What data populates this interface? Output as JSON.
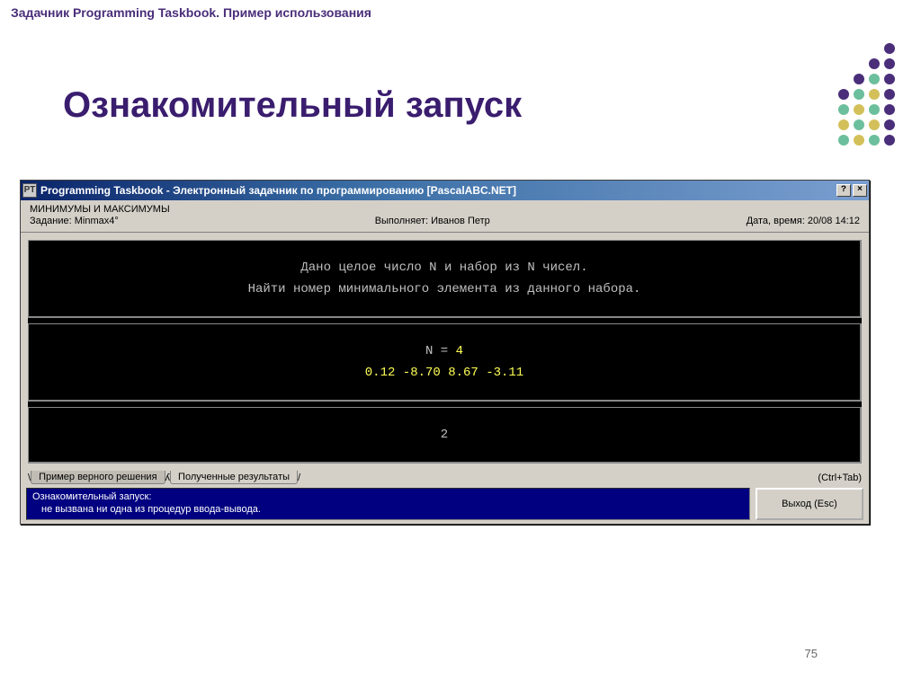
{
  "slide": {
    "header": "Задачник Programming Taskbook. Пример использования",
    "title": "Ознакомительный запуск",
    "page_number": "75"
  },
  "dots": [
    [
      "",
      "",
      "",
      "#4a2e7a",
      ""
    ],
    [
      "",
      "",
      "#4a2e7a",
      "#4a2e7a",
      ""
    ],
    [
      "",
      "#4a2e7a",
      "#6cbf9c",
      "#4a2e7a",
      ""
    ],
    [
      "#4a2e7a",
      "#6cbf9c",
      "#d4c05a",
      "#4a2e7a",
      ""
    ],
    [
      "#6cbf9c",
      "#d4c05a",
      "#6cbf9c",
      "#4a2e7a",
      ""
    ],
    [
      "#d4c05a",
      "#6cbf9c",
      "#d4c05a",
      "#4a2e7a",
      ""
    ],
    [
      "#6cbf9c",
      "#d4c05a",
      "#6cbf9c",
      "#4a2e7a",
      ""
    ]
  ],
  "window": {
    "title": "Programming Taskbook - Электронный задачник по программированию [PascalABC.NET]",
    "icon_text": "PT",
    "help_btn": "?",
    "close_btn": "×"
  },
  "info": {
    "section": "МИНИМУМЫ И МАКСИМУМЫ",
    "task_label": "Задание: Minmax4°",
    "executor_label": "Выполняет: Иванов Петр",
    "datetime_label": "Дата, время: 20/08 14:12"
  },
  "console": {
    "desc_line1": "Дано целое число N и набор из N чисел.",
    "desc_line2": "Найти номер минимального элемента из данного набора.",
    "input_line1_prefix": "N = ",
    "input_line1_value": "4",
    "input_line2": "0.12  -8.70   8.67  -3.11",
    "output_line": "2"
  },
  "tabs": {
    "tab1": "Пример верного решения",
    "tab2": "Полученные результаты",
    "shortcut": "(Ctrl+Tab)"
  },
  "status": {
    "line1": "Ознакомительный запуск:",
    "line2": "не вызвана ни одна из процедур ввода-вывода."
  },
  "exit_button": "Выход (Esc)"
}
